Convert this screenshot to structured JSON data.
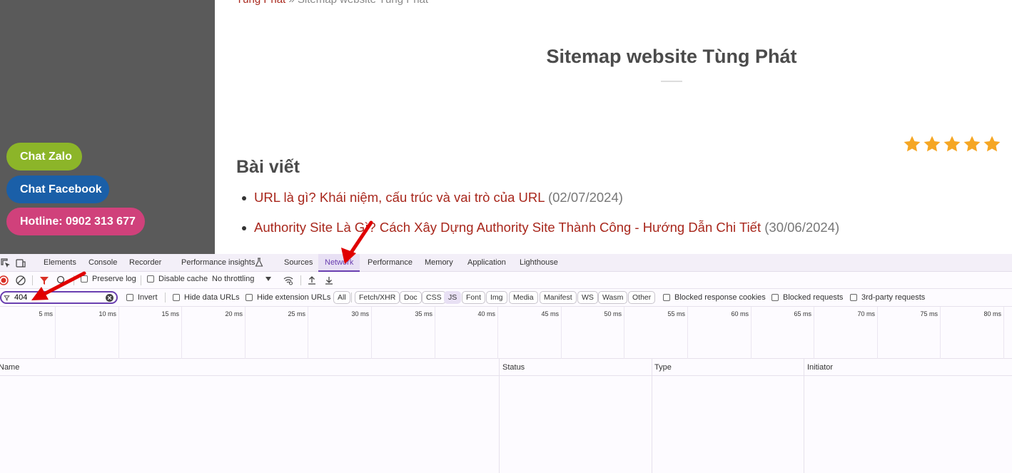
{
  "site": {
    "breadcrumb": {
      "home": "Tùng Phát",
      "separator": " » ",
      "current": "Sitemap website Tùng Phát"
    },
    "page_title": "Sitemap website Tùng Phát",
    "section_heading": "Bài viết",
    "rating": {
      "stars": 5,
      "max": 5,
      "color": "#f5a623"
    },
    "posts": [
      {
        "title": "URL là gì? Khái niệm, cấu trúc và vai trò của URL",
        "date": "(02/07/2024)"
      },
      {
        "title": "Authority Site Là Gì? Cách Xây Dựng Authority Site Thành Công - Hướng Dẫn Chi Tiết",
        "date": "(30/06/2024)"
      }
    ],
    "chat_buttons": [
      {
        "label": "Chat Zalo",
        "color": "#8cb529"
      },
      {
        "label": "Chat Facebook",
        "color": "#1a5fa8"
      },
      {
        "label": "Hotline: 0902 313 677",
        "color": "#d0417b"
      }
    ]
  },
  "devtools": {
    "tabs": [
      "Elements",
      "Console",
      "Recorder",
      "Performance insights",
      "Sources",
      "Network",
      "Performance",
      "Memory",
      "Application",
      "Lighthouse"
    ],
    "active_tab": "Network",
    "toolbar": {
      "preserve_log": "Preserve log",
      "disable_cache": "Disable cache",
      "throttling": "No throttling"
    },
    "filter": {
      "value": "404",
      "invert": "Invert",
      "hide_data_urls": "Hide data URLs",
      "hide_extension_urls": "Hide extension URLs",
      "types": [
        "All",
        "Fetch/XHR",
        "Doc",
        "CSS",
        "JS",
        "Font",
        "Img",
        "Media",
        "Manifest",
        "WS",
        "Wasm",
        "Other"
      ],
      "active_type": "JS",
      "blocked_response_cookies": "Blocked response cookies",
      "blocked_requests": "Blocked requests",
      "third_party": "3rd-party requests"
    },
    "timeline_ticks": [
      "5 ms",
      "10 ms",
      "15 ms",
      "20 ms",
      "25 ms",
      "30 ms",
      "35 ms",
      "40 ms",
      "45 ms",
      "50 ms",
      "55 ms",
      "60 ms",
      "65 ms",
      "70 ms",
      "75 ms",
      "80 ms"
    ],
    "columns": [
      "Name",
      "Status",
      "Type",
      "Initiator"
    ]
  },
  "icons": {
    "inspect": "inspect-icon",
    "device": "device-toggle-icon",
    "flask": "experiment-flask-icon",
    "record": "record-stop-icon",
    "clear": "clear-icon",
    "filter": "filter-icon",
    "search": "search-icon",
    "online": "network-conditions-icon",
    "upload": "import-har-icon",
    "download": "export-har-icon",
    "star": "star-icon",
    "arrow": "red-arrow-annotation"
  }
}
